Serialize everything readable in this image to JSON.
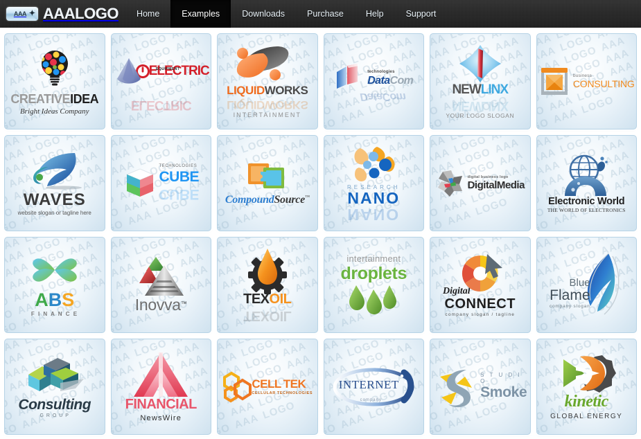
{
  "header": {
    "brand": {
      "mark_text": "AAA",
      "mark_plus": "✦",
      "name": "AAALOGO"
    },
    "nav": [
      {
        "label": "Home",
        "active": false
      },
      {
        "label": "Examples",
        "active": true
      },
      {
        "label": "Downloads",
        "active": false
      },
      {
        "label": "Purchase",
        "active": false
      },
      {
        "label": "Help",
        "active": false
      },
      {
        "label": "Support",
        "active": false
      }
    ]
  },
  "gallery": {
    "watermark": "AAA LOGO",
    "tiles": [
      {
        "id": "creative-idea",
        "name_primary": "CREATIVE",
        "name_secondary": "IDEA",
        "tagline": "Bright Ideas Company",
        "colors": {
          "primary": "#8a8a8a",
          "secondary": "#222222"
        }
      },
      {
        "id": "electric",
        "name_primary": "ELECTRIC",
        "name_secondary": "",
        "tagline": "EQUIPMENT",
        "colors": {
          "primary": "#d4202a",
          "secondary": "#5b6fae"
        }
      },
      {
        "id": "liquid-works",
        "name_primary": "LIQUID",
        "name_secondary": "WORKS",
        "tagline": "INTERTAINMENT",
        "colors": {
          "primary": "#ef6c1f",
          "secondary": "#4a4a4a"
        }
      },
      {
        "id": "data-com",
        "name_primary": "Data",
        "name_secondary": "Com",
        "tagline": "technologies",
        "colors": {
          "primary": "#1a4e9b",
          "secondary": "#8fa0ad"
        }
      },
      {
        "id": "new-linx",
        "name_primary": "NEW",
        "name_secondary": "LINX",
        "tagline": "YOUR LOGO SLOGAN",
        "colors": {
          "primary": "#4a4a4a",
          "secondary": "#3fa9e0"
        }
      },
      {
        "id": "consulting",
        "name_primary": "CONSULTING",
        "name_secondary": "",
        "tagline": "business",
        "colors": {
          "primary": "#f08a1e",
          "secondary": "#9aa4ac"
        }
      },
      {
        "id": "waves",
        "name_primary": "WAVES",
        "name_secondary": "",
        "tagline": "website slogan or tagline here",
        "colors": {
          "primary": "#2b6fc4",
          "secondary": "#3a3a3a"
        }
      },
      {
        "id": "cube",
        "name_primary": "CUBE",
        "name_secondary": "",
        "tagline": "TECHNOLOGIES",
        "colors": {
          "primary": "#2196f3",
          "secondary": "#4caf50"
        }
      },
      {
        "id": "compound-source",
        "name_primary": "Compound",
        "name_secondary": "Source",
        "tagline": "™",
        "colors": {
          "primary": "#2f7fd0",
          "secondary": "#f0922b"
        }
      },
      {
        "id": "nano",
        "name_primary": "NANO",
        "name_secondary": "",
        "tagline": "RESEARCH",
        "colors": {
          "primary": "#1565c0",
          "secondary": "#f5a623"
        }
      },
      {
        "id": "digital-media",
        "name_primary": "Digital",
        "name_secondary": "Media",
        "tagline": "digital business logo",
        "colors": {
          "primary": "#3a3a3a",
          "secondary": "#9e9e9e"
        }
      },
      {
        "id": "electronic-world",
        "name_primary": "Electronic World",
        "name_secondary": "",
        "tagline": "THE WORLD OF ELECTRONICS",
        "colors": {
          "primary": "#2c2c2c",
          "secondary": "#3d6fa5"
        }
      },
      {
        "id": "abs-finance",
        "name_primary": "ABS",
        "name_secondary": "",
        "tagline": "F I N A N C E",
        "colors": {
          "primary": "#4caf50",
          "secondary": "#29b6f6"
        }
      },
      {
        "id": "inovva",
        "name_primary": "Inovva",
        "name_secondary": "™",
        "tagline": "",
        "colors": {
          "primary": "#7a7a7a",
          "secondary": "#d32f2f"
        }
      },
      {
        "id": "tex-oil",
        "name_primary": "TEX",
        "name_secondary": "OIL",
        "tagline": "",
        "colors": {
          "primary": "#2b2b2b",
          "secondary": "#f5921e"
        }
      },
      {
        "id": "droplets",
        "name_primary": "droplets",
        "name_secondary": "",
        "tagline": "intertainment",
        "colors": {
          "primary": "#6ab43f",
          "secondary": "#9e9e9e"
        }
      },
      {
        "id": "digital-connect",
        "name_primary": "Digital",
        "name_secondary": "CONNECT",
        "tagline": "company  slogan / tagline",
        "colors": {
          "primary": "#f5c518",
          "secondary": "#e0503a"
        }
      },
      {
        "id": "blue-flame",
        "name_primary": "Blue",
        "name_secondary": "Flame",
        "tagline": "company slogan",
        "colors": {
          "primary": "#1b4fa0",
          "secondary": "#5f6e78"
        }
      },
      {
        "id": "consulting-group",
        "name_primary": "Consulting",
        "name_secondary": "",
        "tagline": "G R O U P",
        "colors": {
          "primary": "#2a3b47",
          "secondary": "#8bc34a"
        }
      },
      {
        "id": "financial-newswire",
        "name_primary": "FINANCIAL",
        "name_secondary": "",
        "tagline": "NewsWire",
        "colors": {
          "primary": "#e8566b",
          "secondary": "#333333"
        }
      },
      {
        "id": "cell-tek",
        "name_primary": "CELL",
        "name_secondary": "TEK",
        "tagline": "CELLULAR TECHNOLOGIES",
        "colors": {
          "primary": "#ef7622",
          "secondary": "#f5c518"
        }
      },
      {
        "id": "internet",
        "name_primary": "INTERNET",
        "name_secondary": "",
        "tagline": "company",
        "colors": {
          "primary": "#2b4f8e",
          "secondary": "#3f6fb5"
        }
      },
      {
        "id": "studio-smoke",
        "name_primary": "Smoke",
        "name_secondary": "",
        "tagline": "S T U D I O",
        "colors": {
          "primary": "#7d93a6",
          "secondary": "#f5c518"
        }
      },
      {
        "id": "kinetic",
        "name_primary": "kinetic",
        "name_secondary": "",
        "tagline": "GLOBAL ENERGY",
        "colors": {
          "primary": "#6aa82e",
          "secondary": "#ef8023"
        }
      }
    ]
  }
}
